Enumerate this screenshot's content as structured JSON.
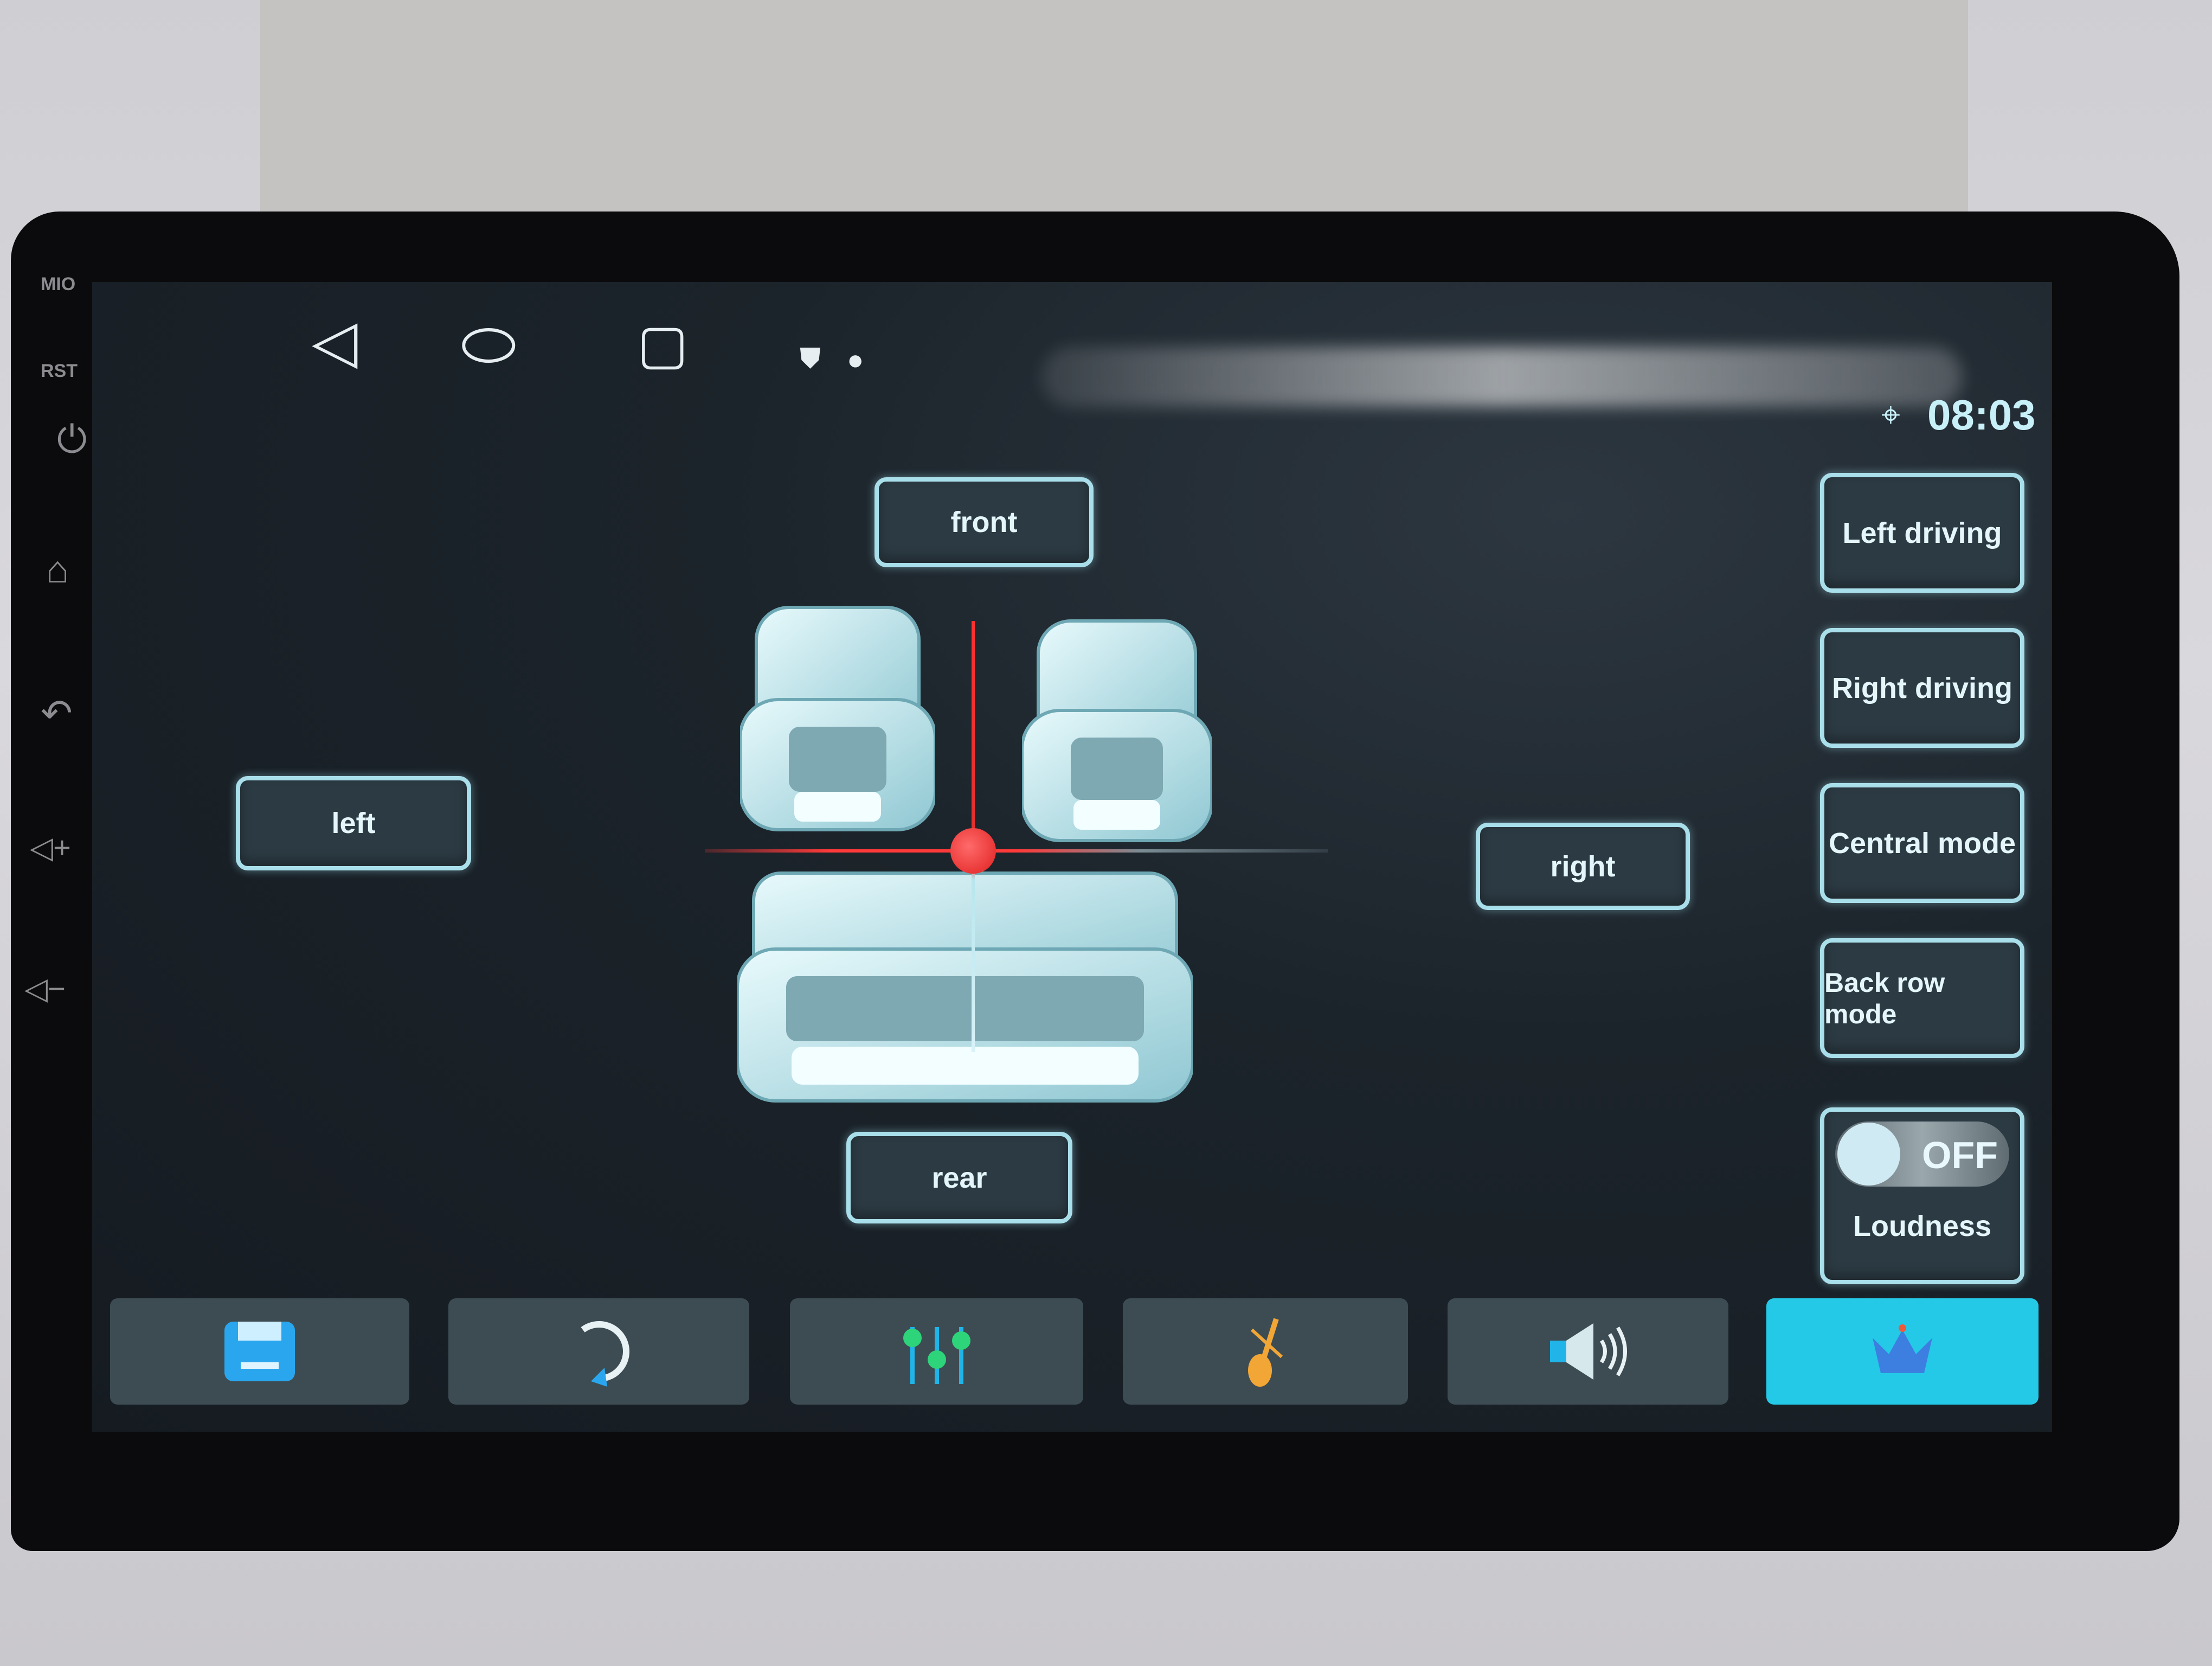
{
  "bezel": {
    "labels": [
      "MIO",
      "RST"
    ],
    "buttons": [
      {
        "icon": "power-icon",
        "glyph": "⏻"
      },
      {
        "icon": "home-icon",
        "glyph": "⌂"
      },
      {
        "icon": "back-icon",
        "glyph": "↶"
      },
      {
        "icon": "volume-up-icon",
        "glyph": "◁+"
      },
      {
        "icon": "volume-down-icon",
        "glyph": "◁−"
      }
    ]
  },
  "status_bar": {
    "nav": [
      {
        "icon": "back-triangle-icon",
        "glyph": "◁"
      },
      {
        "icon": "home-pill-icon",
        "glyph": "⬭"
      },
      {
        "icon": "recents-square-icon",
        "glyph": "▢"
      }
    ],
    "notification_icons": [
      {
        "icon": "shield-icon",
        "glyph": "⛊"
      },
      {
        "icon": "record-dot-icon",
        "glyph": "●"
      }
    ],
    "location_icon": "location-pin-icon",
    "time": "08:03"
  },
  "balance": {
    "front_label": "front",
    "rear_label": "rear",
    "left_label": "left",
    "right_label": "right"
  },
  "modes": {
    "left_driving": "Left driving",
    "right_driving": "Right driving",
    "central_mode": "Central mode",
    "back_row_mode": "Back row mode",
    "loudness": {
      "label": "Loudness",
      "state": "OFF"
    }
  },
  "toolbar": {
    "items": [
      {
        "icon": "save-icon",
        "active": false
      },
      {
        "icon": "reset-icon",
        "active": false
      },
      {
        "icon": "equalizer-icon",
        "active": false
      },
      {
        "icon": "sound-effect-guitar-icon",
        "active": false
      },
      {
        "icon": "volume-icon",
        "active": false
      },
      {
        "icon": "crown-vip-icon",
        "active": true
      }
    ],
    "accent_color": "#24c9e8"
  },
  "colors": {
    "button_border": "#a9dfea",
    "button_bg": "#2c3a43",
    "crosshair": "#ff3a3a"
  }
}
